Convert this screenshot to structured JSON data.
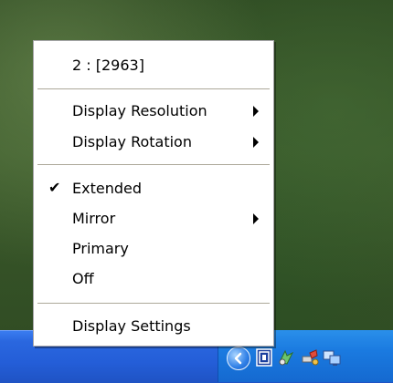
{
  "menu": {
    "header": "2 : [2963]",
    "items": [
      {
        "label": "Display Resolution",
        "submenu": true
      },
      {
        "label": "Display Rotation",
        "submenu": true
      },
      {
        "label": "Extended",
        "checked": true,
        "check_glyph": "✔"
      },
      {
        "label": "Mirror",
        "submenu": true
      },
      {
        "label": "Primary"
      },
      {
        "label": "Off"
      },
      {
        "label": "Display Settings"
      }
    ]
  },
  "tray": {
    "icons": [
      "expand-chevron-icon",
      "display-manager-icon",
      "network-icon",
      "connect-icon",
      "monitor-icon"
    ]
  },
  "colors": {
    "menu_bg": "#ffffff",
    "separator": "#aca899",
    "taskbar": "#245ed8",
    "tray": "#1a7ae0"
  }
}
